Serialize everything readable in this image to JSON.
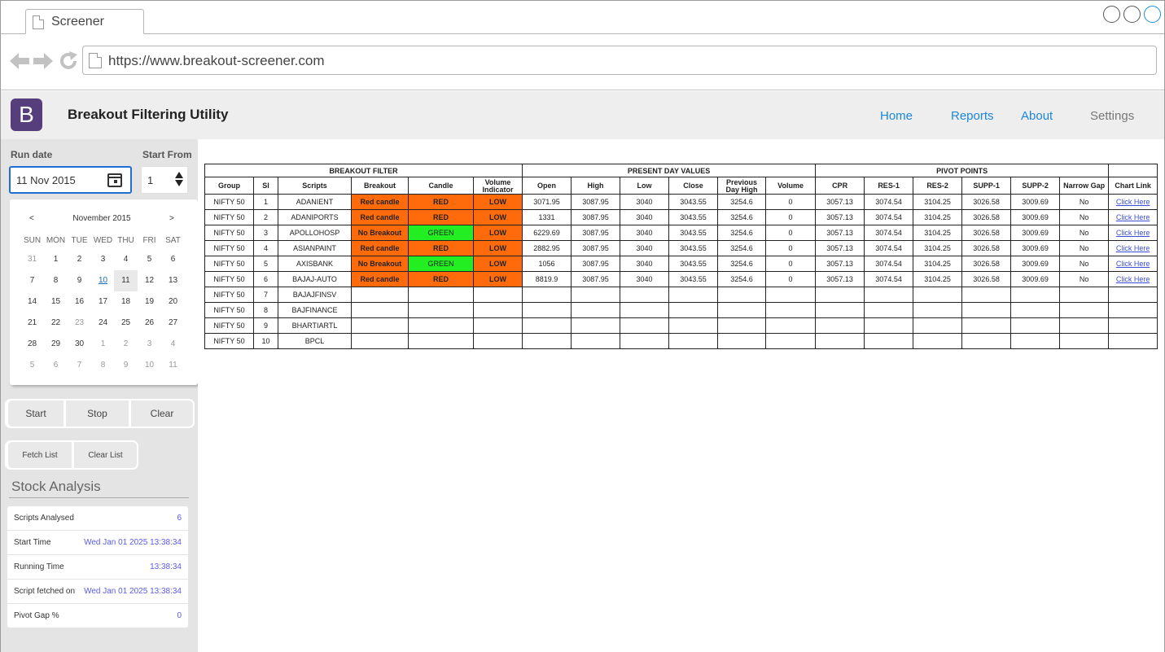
{
  "browser": {
    "tab_title": "Screener",
    "url": "https://www.breakout-screener.com"
  },
  "app": {
    "title": "Breakout Filtering Utility",
    "logo_letter": "B",
    "logo_color": "#563d7c",
    "nav": [
      "Home",
      "Reports",
      "About",
      "Settings"
    ]
  },
  "sidebar": {
    "run_date_label": "Run date",
    "run_date_value": "11 Nov 2015",
    "start_from_label": "Start From",
    "start_from_value": "1",
    "calendar": {
      "prev": "<",
      "next": ">",
      "month": "November 2015",
      "dow": [
        "SUN",
        "MON",
        "TUE",
        "WED",
        "THU",
        "FRI",
        "SAT"
      ],
      "weeks": [
        [
          "31",
          "1",
          "2",
          "3",
          "4",
          "5",
          "6"
        ],
        [
          "7",
          "8",
          "9",
          "10",
          "11",
          "12",
          "13"
        ],
        [
          "14",
          "15",
          "16",
          "17",
          "18",
          "19",
          "20"
        ],
        [
          "21",
          "22",
          "23",
          "24",
          "25",
          "26",
          "27"
        ],
        [
          "28",
          "29",
          "30",
          "1",
          "2",
          "3",
          "4"
        ],
        [
          "5",
          "6",
          "7",
          "8",
          "9",
          "10",
          "11"
        ]
      ]
    },
    "buttons": {
      "start": "Start",
      "stop": "Stop",
      "clear": "Clear",
      "fetch_list": "Fetch List",
      "clear_list": "Clear List"
    },
    "stock_analysis": {
      "title": "Stock Analysis",
      "rows": [
        {
          "label": "Scripts Analysed",
          "value": "6"
        },
        {
          "label": "Start Time",
          "value": "Wed Jan 01 2025 13:38:34"
        },
        {
          "label": "Running Time",
          "value": "13:38:34"
        },
        {
          "label": "Script fetched on",
          "value": "Wed Jan 01 2025 13:38:34"
        },
        {
          "label": "Pivot Gap %",
          "value": "0"
        }
      ]
    }
  },
  "table": {
    "groups": [
      "BREAKOUT FILTER",
      "PRESENT DAY VALUES",
      "PIVOT POINTS",
      ""
    ],
    "headers": [
      "Group",
      "Sl",
      "Scripts",
      "Breakout",
      "Candle",
      "Volume Indicator",
      "Open",
      "High",
      "Low",
      "Close",
      "Previous Day High",
      "Volume",
      "CPR",
      "RES-1",
      "RES-2",
      "SUPP-1",
      "SUPP-2",
      "Narrow Gap",
      "Chart Link"
    ],
    "colors": {
      "breakout": "#ff6b0a",
      "green": "#22ee22"
    },
    "rows": [
      {
        "group": "NIFTY 50",
        "sl": "1",
        "script": "ADANIENT",
        "breakout": "Red candle",
        "candle": "RED",
        "volume_ind": "LOW",
        "open": "3071.95",
        "high": "3087.95",
        "low": "3040",
        "close": "3043.55",
        "prev_high": "3254.6",
        "volume": "0",
        "cpr": "3057.13",
        "res1": "3074.54",
        "res2": "3104.25",
        "supp1": "3026.58",
        "supp2": "3009.69",
        "narrow": "No",
        "chart": "Click Here"
      },
      {
        "group": "NIFTY 50",
        "sl": "2",
        "script": "ADANIPORTS",
        "breakout": "Red candle",
        "candle": "RED",
        "volume_ind": "LOW",
        "open": "1331",
        "high": "3087.95",
        "low": "3040",
        "close": "3043.55",
        "prev_high": "3254.6",
        "volume": "0",
        "cpr": "3057.13",
        "res1": "3074.54",
        "res2": "3104.25",
        "supp1": "3026.58",
        "supp2": "3009.69",
        "narrow": "No",
        "chart": "Click Here"
      },
      {
        "group": "NIFTY 50",
        "sl": "3",
        "script": "APOLLOHOSP",
        "breakout": "No Breakout",
        "candle": "GREEN",
        "volume_ind": "LOW",
        "open": "6229.69",
        "high": "3087.95",
        "low": "3040",
        "close": "3043.55",
        "prev_high": "3254.6",
        "volume": "0",
        "cpr": "3057.13",
        "res1": "3074.54",
        "res2": "3104.25",
        "supp1": "3026.58",
        "supp2": "3009.69",
        "narrow": "No",
        "chart": "Click Here"
      },
      {
        "group": "NIFTY 50",
        "sl": "4",
        "script": "ASIANPAINT",
        "breakout": "Red candle",
        "candle": "RED",
        "volume_ind": "LOW",
        "open": "2882.95",
        "high": "3087.95",
        "low": "3040",
        "close": "3043.55",
        "prev_high": "3254.6",
        "volume": "0",
        "cpr": "3057.13",
        "res1": "3074.54",
        "res2": "3104.25",
        "supp1": "3026.58",
        "supp2": "3009.69",
        "narrow": "No",
        "chart": "Click Here"
      },
      {
        "group": "NIFTY 50",
        "sl": "5",
        "script": "AXISBANK",
        "breakout": "No Breakout",
        "candle": "GREEN",
        "volume_ind": "LOW",
        "open": "1056",
        "high": "3087.95",
        "low": "3040",
        "close": "3043.55",
        "prev_high": "3254.6",
        "volume": "0",
        "cpr": "3057.13",
        "res1": "3074.54",
        "res2": "3104.25",
        "supp1": "3026.58",
        "supp2": "3009.69",
        "narrow": "No",
        "chart": "Click Here"
      },
      {
        "group": "NIFTY 50",
        "sl": "6",
        "script": "BAJAJ-AUTO",
        "breakout": "Red candle",
        "candle": "RED",
        "volume_ind": "LOW",
        "open": "8819.9",
        "high": "3087.95",
        "low": "3040",
        "close": "3043.55",
        "prev_high": "3254.6",
        "volume": "0",
        "cpr": "3057.13",
        "res1": "3074.54",
        "res2": "3104.25",
        "supp1": "3026.58",
        "supp2": "3009.69",
        "narrow": "No",
        "chart": "Click Here"
      },
      {
        "group": "NIFTY 50",
        "sl": "7",
        "script": "BAJAJFINSV"
      },
      {
        "group": "NIFTY 50",
        "sl": "8",
        "script": "BAJFINANCE"
      },
      {
        "group": "NIFTY 50",
        "sl": "9",
        "script": "BHARTIARTL"
      },
      {
        "group": "NIFTY 50",
        "sl": "10",
        "script": "BPCL"
      }
    ]
  }
}
